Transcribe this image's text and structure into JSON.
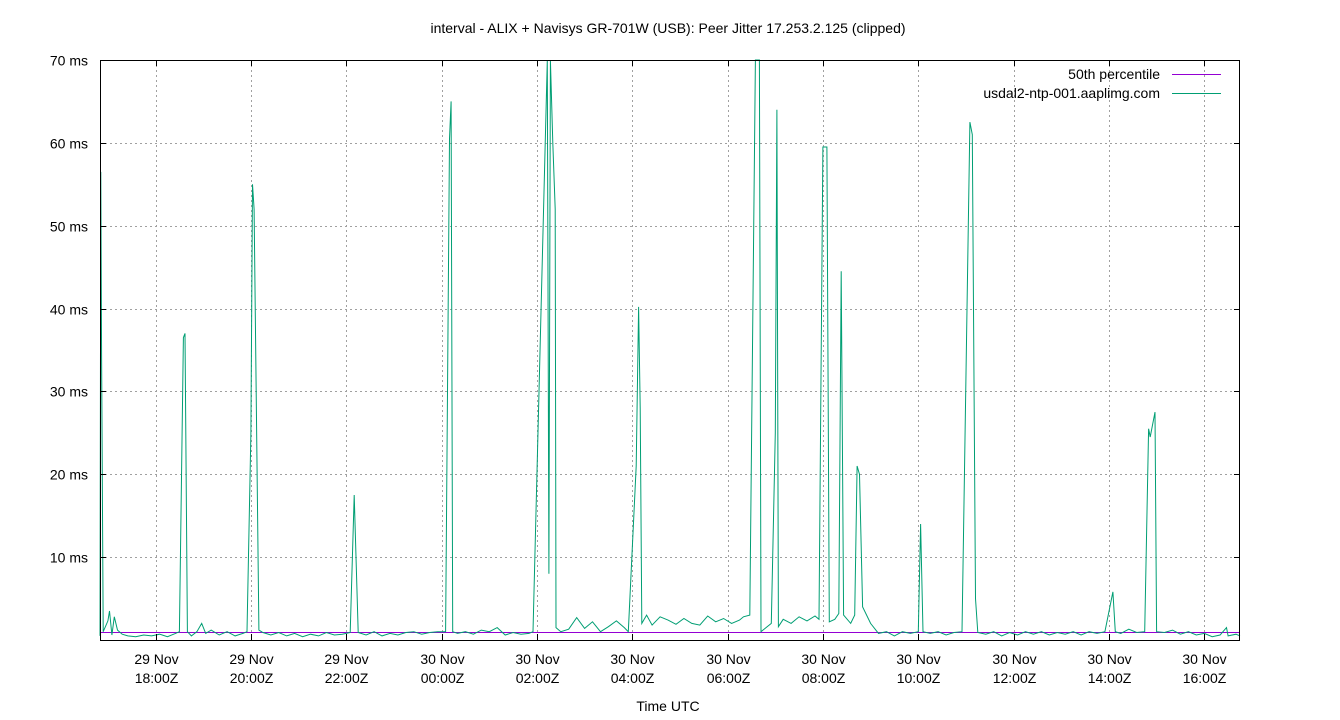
{
  "chart_data": {
    "type": "line",
    "title": "interval - ALIX + Navisys GR-701W (USB): Peer Jitter 17.253.2.125 (clipped)",
    "xlabel": "Time UTC",
    "ylabel": "",
    "ylim": [
      0,
      70
    ],
    "xlim": [
      "29 Nov 16:50Z",
      "30 Nov 16:45Z"
    ],
    "y_ticks": [
      {
        "value": 10,
        "label": "10 ms"
      },
      {
        "value": 20,
        "label": "20 ms"
      },
      {
        "value": 30,
        "label": "30 ms"
      },
      {
        "value": 40,
        "label": "40 ms"
      },
      {
        "value": 50,
        "label": "50 ms"
      },
      {
        "value": 60,
        "label": "60 ms"
      },
      {
        "value": 70,
        "label": "70 ms"
      }
    ],
    "x_ticks": [
      {
        "time": "29 Nov 18:00Z",
        "line1": "29 Nov",
        "line2": "18:00Z"
      },
      {
        "time": "29 Nov 20:00Z",
        "line1": "29 Nov",
        "line2": "20:00Z"
      },
      {
        "time": "29 Nov 22:00Z",
        "line1": "29 Nov",
        "line2": "22:00Z"
      },
      {
        "time": "30 Nov 00:00Z",
        "line1": "30 Nov",
        "line2": "00:00Z"
      },
      {
        "time": "30 Nov 02:00Z",
        "line1": "30 Nov",
        "line2": "02:00Z"
      },
      {
        "time": "30 Nov 04:00Z",
        "line1": "30 Nov",
        "line2": "04:00Z"
      },
      {
        "time": "30 Nov 06:00Z",
        "line1": "30 Nov",
        "line2": "06:00Z"
      },
      {
        "time": "30 Nov 08:00Z",
        "line1": "30 Nov",
        "line2": "08:00Z"
      },
      {
        "time": "30 Nov 10:00Z",
        "line1": "30 Nov",
        "line2": "10:00Z"
      },
      {
        "time": "30 Nov 12:00Z",
        "line1": "30 Nov",
        "line2": "12:00Z"
      },
      {
        "time": "30 Nov 14:00Z",
        "line1": "30 Nov",
        "line2": "14:00Z"
      },
      {
        "time": "30 Nov 16:00Z",
        "line1": "30 Nov",
        "line2": "16:00Z"
      }
    ],
    "grid": true,
    "legend_position": "top-right",
    "series": [
      {
        "name": "50th percentile",
        "color": "#9400d3",
        "points": [
          [
            "29 Nov 16:50Z",
            0.9
          ],
          [
            "30 Nov 16:45Z",
            0.9
          ]
        ]
      },
      {
        "name": "usdal2-ntp-001.aaplimg.com",
        "color": "#009e73",
        "points": [
          [
            "29 Nov 16:50Z",
            0.5
          ],
          [
            "29 Nov 16:51Z",
            56.5
          ],
          [
            "29 Nov 16:52Z",
            34
          ],
          [
            "29 Nov 16:54Z",
            1
          ],
          [
            "29 Nov 17:00Z",
            2.3
          ],
          [
            "29 Nov 17:02Z",
            3.5
          ],
          [
            "29 Nov 17:05Z",
            0.6
          ],
          [
            "29 Nov 17:08Z",
            2.8
          ],
          [
            "29 Nov 17:12Z",
            1.2
          ],
          [
            "29 Nov 17:18Z",
            0.7
          ],
          [
            "29 Nov 17:25Z",
            0.5
          ],
          [
            "29 Nov 17:35Z",
            0.4
          ],
          [
            "29 Nov 17:45Z",
            0.6
          ],
          [
            "29 Nov 17:55Z",
            0.5
          ],
          [
            "29 Nov 18:05Z",
            0.7
          ],
          [
            "29 Nov 18:15Z",
            0.4
          ],
          [
            "29 Nov 18:25Z",
            0.8
          ],
          [
            "29 Nov 18:30Z",
            1.0
          ],
          [
            "29 Nov 18:35Z",
            36.5
          ],
          [
            "29 Nov 18:37Z",
            37
          ],
          [
            "29 Nov 18:40Z",
            1.0
          ],
          [
            "29 Nov 18:45Z",
            0.5
          ],
          [
            "29 Nov 18:52Z",
            1.0
          ],
          [
            "29 Nov 18:58Z",
            2.0
          ],
          [
            "29 Nov 19:03Z",
            0.8
          ],
          [
            "29 Nov 19:10Z",
            1.2
          ],
          [
            "29 Nov 19:20Z",
            0.6
          ],
          [
            "29 Nov 19:30Z",
            1.0
          ],
          [
            "29 Nov 19:40Z",
            0.5
          ],
          [
            "29 Nov 19:50Z",
            0.8
          ],
          [
            "29 Nov 19:55Z",
            1.0
          ],
          [
            "29 Nov 20:00Z",
            25
          ],
          [
            "29 Nov 20:02Z",
            55
          ],
          [
            "29 Nov 20:04Z",
            52
          ],
          [
            "29 Nov 20:10Z",
            1.2
          ],
          [
            "29 Nov 20:15Z",
            0.9
          ],
          [
            "29 Nov 20:25Z",
            0.6
          ],
          [
            "29 Nov 20:35Z",
            0.9
          ],
          [
            "29 Nov 20:45Z",
            0.5
          ],
          [
            "29 Nov 20:55Z",
            0.8
          ],
          [
            "29 Nov 21:05Z",
            0.4
          ],
          [
            "29 Nov 21:15Z",
            0.7
          ],
          [
            "29 Nov 21:25Z",
            0.5
          ],
          [
            "29 Nov 21:35Z",
            0.9
          ],
          [
            "29 Nov 21:45Z",
            0.6
          ],
          [
            "29 Nov 21:55Z",
            0.7
          ],
          [
            "29 Nov 22:05Z",
            0.9
          ],
          [
            "29 Nov 22:10Z",
            17.5
          ],
          [
            "29 Nov 22:15Z",
            0.9
          ],
          [
            "29 Nov 22:25Z",
            0.6
          ],
          [
            "29 Nov 22:35Z",
            1.0
          ],
          [
            "29 Nov 22:45Z",
            0.5
          ],
          [
            "29 Nov 22:55Z",
            0.8
          ],
          [
            "29 Nov 23:05Z",
            0.6
          ],
          [
            "29 Nov 23:15Z",
            0.9
          ],
          [
            "29 Nov 23:25Z",
            1.0
          ],
          [
            "29 Nov 23:35Z",
            0.7
          ],
          [
            "29 Nov 23:45Z",
            0.9
          ],
          [
            "29 Nov 23:55Z",
            1.0
          ],
          [
            "30 Nov 00:05Z",
            1.0
          ],
          [
            "30 Nov 00:10Z",
            60.5
          ],
          [
            "30 Nov 00:12Z",
            65
          ],
          [
            "30 Nov 00:14Z",
            1.0
          ],
          [
            "30 Nov 00:20Z",
            0.8
          ],
          [
            "30 Nov 00:30Z",
            1.0
          ],
          [
            "30 Nov 00:40Z",
            0.7
          ],
          [
            "30 Nov 00:50Z",
            1.2
          ],
          [
            "30 Nov 01:00Z",
            1.0
          ],
          [
            "30 Nov 01:10Z",
            1.5
          ],
          [
            "30 Nov 01:20Z",
            0.6
          ],
          [
            "30 Nov 01:30Z",
            0.9
          ],
          [
            "30 Nov 01:40Z",
            0.7
          ],
          [
            "30 Nov 01:50Z",
            0.8
          ],
          [
            "30 Nov 01:55Z",
            1.0
          ],
          [
            "30 Nov 02:13Z",
            70
          ],
          [
            "30 Nov 02:15Z",
            8
          ],
          [
            "30 Nov 02:17Z",
            70
          ],
          [
            "30 Nov 02:20Z",
            60
          ],
          [
            "30 Nov 02:23Z",
            52
          ],
          [
            "30 Nov 02:24Z",
            1.5
          ],
          [
            "30 Nov 02:30Z",
            1.0
          ],
          [
            "30 Nov 02:40Z",
            1.3
          ],
          [
            "30 Nov 02:50Z",
            2.7
          ],
          [
            "30 Nov 03:00Z",
            1.4
          ],
          [
            "30 Nov 03:10Z",
            2.2
          ],
          [
            "30 Nov 03:20Z",
            1.0
          ],
          [
            "30 Nov 03:30Z",
            1.6
          ],
          [
            "30 Nov 03:40Z",
            2.3
          ],
          [
            "30 Nov 03:50Z",
            1.5
          ],
          [
            "30 Nov 03:55Z",
            1.0
          ],
          [
            "30 Nov 04:05Z",
            21
          ],
          [
            "30 Nov 04:08Z",
            40.2
          ],
          [
            "30 Nov 04:10Z",
            28
          ],
          [
            "30 Nov 04:12Z",
            2.0
          ],
          [
            "30 Nov 04:18Z",
            3.0
          ],
          [
            "30 Nov 04:25Z",
            1.8
          ],
          [
            "30 Nov 04:35Z",
            2.8
          ],
          [
            "30 Nov 04:45Z",
            2.4
          ],
          [
            "30 Nov 04:55Z",
            1.9
          ],
          [
            "30 Nov 05:05Z",
            2.6
          ],
          [
            "30 Nov 05:15Z",
            2.0
          ],
          [
            "30 Nov 05:25Z",
            1.8
          ],
          [
            "30 Nov 05:35Z",
            2.9
          ],
          [
            "30 Nov 05:45Z",
            2.2
          ],
          [
            "30 Nov 05:55Z",
            2.6
          ],
          [
            "30 Nov 06:05Z",
            2.0
          ],
          [
            "30 Nov 06:15Z",
            2.4
          ],
          [
            "30 Nov 06:20Z",
            2.8
          ],
          [
            "30 Nov 06:28Z",
            3.0
          ],
          [
            "30 Nov 06:35Z",
            70
          ],
          [
            "30 Nov 06:40Z",
            70
          ],
          [
            "30 Nov 06:42Z",
            1.0
          ],
          [
            "30 Nov 06:55Z",
            2.0
          ],
          [
            "30 Nov 07:00Z",
            25
          ],
          [
            "30 Nov 07:02Z",
            64
          ],
          [
            "30 Nov 07:04Z",
            1.6
          ],
          [
            "30 Nov 07:10Z",
            2.5
          ],
          [
            "30 Nov 07:20Z",
            2.0
          ],
          [
            "30 Nov 07:30Z",
            2.8
          ],
          [
            "30 Nov 07:40Z",
            2.3
          ],
          [
            "30 Nov 07:50Z",
            2.9
          ],
          [
            "30 Nov 07:55Z",
            2.5
          ],
          [
            "30 Nov 08:00Z",
            59.5
          ],
          [
            "30 Nov 08:05Z",
            59.5
          ],
          [
            "30 Nov 08:08Z",
            2.2
          ],
          [
            "30 Nov 08:15Z",
            2.5
          ],
          [
            "30 Nov 08:20Z",
            3.2
          ],
          [
            "30 Nov 08:23Z",
            44.5
          ],
          [
            "30 Nov 08:26Z",
            3.0
          ],
          [
            "30 Nov 08:35Z",
            2.0
          ],
          [
            "30 Nov 08:40Z",
            3.0
          ],
          [
            "30 Nov 08:43Z",
            21
          ],
          [
            "30 Nov 08:46Z",
            20
          ],
          [
            "30 Nov 08:50Z",
            4.0
          ],
          [
            "30 Nov 09:00Z",
            2.0
          ],
          [
            "30 Nov 09:10Z",
            0.8
          ],
          [
            "30 Nov 09:20Z",
            1.0
          ],
          [
            "30 Nov 09:30Z",
            0.5
          ],
          [
            "30 Nov 09:40Z",
            1.0
          ],
          [
            "30 Nov 09:50Z",
            0.8
          ],
          [
            "30 Nov 10:00Z",
            1.0
          ],
          [
            "30 Nov 10:03Z",
            14
          ],
          [
            "30 Nov 10:06Z",
            1.0
          ],
          [
            "30 Nov 10:15Z",
            0.8
          ],
          [
            "30 Nov 10:25Z",
            1.0
          ],
          [
            "30 Nov 10:35Z",
            0.6
          ],
          [
            "30 Nov 10:45Z",
            0.9
          ],
          [
            "30 Nov 10:55Z",
            1.0
          ],
          [
            "30 Nov 11:05Z",
            62.5
          ],
          [
            "30 Nov 11:08Z",
            61
          ],
          [
            "30 Nov 11:12Z",
            5
          ],
          [
            "30 Nov 11:15Z",
            0.9
          ],
          [
            "30 Nov 11:25Z",
            0.7
          ],
          [
            "30 Nov 11:35Z",
            1.0
          ],
          [
            "30 Nov 11:45Z",
            0.5
          ],
          [
            "30 Nov 11:55Z",
            0.9
          ],
          [
            "30 Nov 12:05Z",
            0.6
          ],
          [
            "30 Nov 12:15Z",
            1.0
          ],
          [
            "30 Nov 12:25Z",
            0.7
          ],
          [
            "30 Nov 12:35Z",
            1.0
          ],
          [
            "30 Nov 12:45Z",
            0.6
          ],
          [
            "30 Nov 12:55Z",
            0.9
          ],
          [
            "30 Nov 13:05Z",
            0.7
          ],
          [
            "30 Nov 13:15Z",
            1.0
          ],
          [
            "30 Nov 13:25Z",
            0.6
          ],
          [
            "30 Nov 13:35Z",
            1.0
          ],
          [
            "30 Nov 13:45Z",
            0.8
          ],
          [
            "30 Nov 13:55Z",
            1.0
          ],
          [
            "30 Nov 14:05Z",
            5.8
          ],
          [
            "30 Nov 14:08Z",
            1.0
          ],
          [
            "30 Nov 14:15Z",
            0.8
          ],
          [
            "30 Nov 14:25Z",
            1.3
          ],
          [
            "30 Nov 14:35Z",
            0.9
          ],
          [
            "30 Nov 14:45Z",
            1.0
          ],
          [
            "30 Nov 14:50Z",
            25.5
          ],
          [
            "30 Nov 14:52Z",
            24.5
          ],
          [
            "30 Nov 14:58Z",
            27.5
          ],
          [
            "30 Nov 15:00Z",
            1.0
          ],
          [
            "30 Nov 15:10Z",
            0.9
          ],
          [
            "30 Nov 15:20Z",
            1.2
          ],
          [
            "30 Nov 15:30Z",
            0.7
          ],
          [
            "30 Nov 15:40Z",
            1.0
          ],
          [
            "30 Nov 15:50Z",
            0.6
          ],
          [
            "30 Nov 16:00Z",
            0.8
          ],
          [
            "30 Nov 16:10Z",
            0.4
          ],
          [
            "30 Nov 16:20Z",
            0.6
          ],
          [
            "30 Nov 16:28Z",
            1.5
          ],
          [
            "30 Nov 16:30Z",
            0.5
          ],
          [
            "30 Nov 16:40Z",
            0.7
          ],
          [
            "30 Nov 16:45Z",
            0.5
          ]
        ]
      }
    ]
  }
}
